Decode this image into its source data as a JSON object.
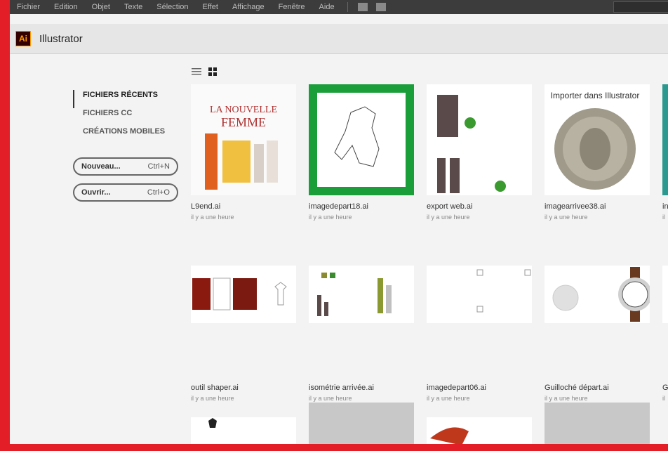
{
  "menubar": {
    "items": [
      "Fichier",
      "Edition",
      "Objet",
      "Texte",
      "Sélection",
      "Effet",
      "Affichage",
      "Fenêtre",
      "Aide"
    ]
  },
  "app": {
    "logo_text": "Ai",
    "title": "Illustrator"
  },
  "sidebar": {
    "items": [
      {
        "label": "FICHIERS RÉCENTS",
        "active": true
      },
      {
        "label": "FICHIERS CC",
        "active": false
      },
      {
        "label": "CRÉATIONS MOBILES",
        "active": false
      }
    ],
    "new_button": {
      "label": "Nouveau...",
      "shortcut": "Ctrl+N"
    },
    "open_button": {
      "label": "Ouvrir...",
      "shortcut": "Ctrl+O"
    }
  },
  "view_toggle": {
    "list_icon": "list-view-icon",
    "grid_icon": "grid-view-icon"
  },
  "files": [
    {
      "name": "L9end.ai",
      "time": "il y a une heure",
      "thumb_text": "LA NOUVELLE FEMME"
    },
    {
      "name": "imagedepart18.ai",
      "time": "il y a une heure"
    },
    {
      "name": "export web.ai",
      "time": "il y a une heure"
    },
    {
      "name": "imagearrivee38.ai",
      "time": "il y a une heure",
      "thumb_text": "Importer dans Illustrator"
    },
    {
      "name": "in",
      "time": "il"
    },
    {
      "name": "outil shaper.ai",
      "time": "il y a une heure"
    },
    {
      "name": "isométrie arrivée.ai",
      "time": "il y a une heure"
    },
    {
      "name": "imagedepart06.ai",
      "time": "il y a une heure"
    },
    {
      "name": "Guilloché départ.ai",
      "time": "il y a une heure"
    },
    {
      "name": "G",
      "time": "il"
    }
  ]
}
